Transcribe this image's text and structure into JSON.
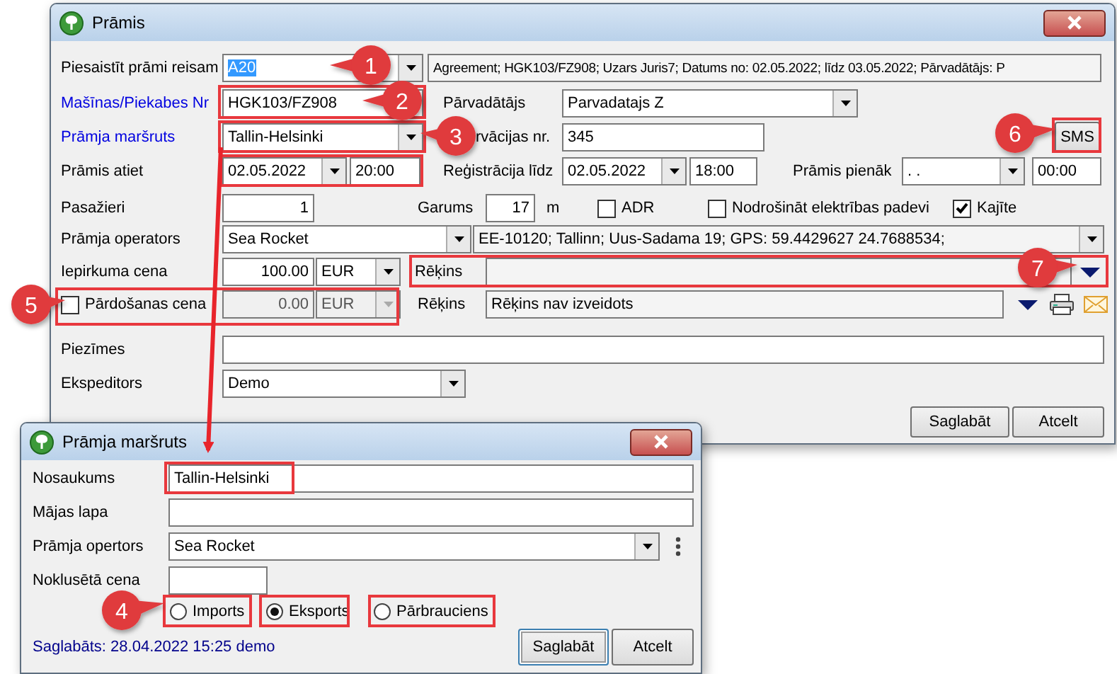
{
  "main_window": {
    "title": "Prāmis",
    "link_trip": {
      "label": "Piesaistīt prāmi reisam",
      "value": "A20",
      "value_selected": true,
      "details": "Agreement; HGK103/FZ908; Uzars Juris7; Datums no: 02.05.2022; līdz 03.05.2022; Pārvadātājs: P"
    },
    "vehicle_nr": {
      "label": "Mašīnas/Piekabes Nr",
      "link": true,
      "value": "HGK103/FZ908"
    },
    "carrier": {
      "label": "Pārvadātājs",
      "value": "Parvadatajs Z"
    },
    "route": {
      "label": "Prāmja maršruts",
      "link": true,
      "value": "Tallin-Helsinki"
    },
    "reservation_nr": {
      "label": "rvācijas nr.",
      "value": "345"
    },
    "sms_button": "SMS",
    "departure": {
      "label": "Prāmis atiet",
      "date": "02.05.2022",
      "time": "20:00"
    },
    "registration_until": {
      "label": "Reģistrācija līdz",
      "date": "02.05.2022",
      "time": "18:00"
    },
    "arrival": {
      "label": "Prāmis pienāk",
      "date": ". .",
      "time": "00:00"
    },
    "passengers": {
      "label": "Pasažieri",
      "value": "1"
    },
    "length": {
      "label": "Garums",
      "value": "17",
      "unit": "m"
    },
    "options": [
      {
        "label": "ADR",
        "checked": false
      },
      {
        "label": "Nodrošināt elektrības padevi",
        "checked": false
      },
      {
        "label": "Kajīte",
        "checked": true
      }
    ],
    "operator": {
      "label": "Prāmja operators",
      "value": "Sea Rocket",
      "details": "EE-10120; Tallinn; Uus-Sadama 19; GPS: 59.4429627 24.7688534;"
    },
    "purchase_price": {
      "label": "Iepirkuma cena",
      "value": "100.00",
      "currency": "EUR",
      "invoice_label": "Rēķins"
    },
    "sale_price": {
      "label": "Pārdošanas cena",
      "checked": false,
      "value": "0.00",
      "currency": "EUR",
      "invoice_label": "Rēķins",
      "invoice": "Rēķins nav izveidots"
    },
    "notes": {
      "label": "Piezīmes"
    },
    "forwarder": {
      "label": "Ekspeditors",
      "value": "Demo"
    },
    "buttons": [
      "Saglabāt",
      "Atcelt"
    ]
  },
  "route_window": {
    "title": "Prāmja maršruts",
    "name": {
      "label": "Nosaukums",
      "value": "Tallin-Helsinki"
    },
    "homepage": {
      "label": "Mājas lapa"
    },
    "operator": {
      "label": "Prāmja opertors",
      "value": "Sea Rocket"
    },
    "default_price": {
      "label": "Noklusētā cena"
    },
    "direction": [
      {
        "label": "Imports",
        "selected": false
      },
      {
        "label": "Eksports",
        "selected": true
      },
      {
        "label": "Pārbrauciens",
        "selected": false
      }
    ],
    "saved": "Saglabāts: 28.04.2022 15:25 demo",
    "buttons": [
      "Saglabāt",
      "Atcelt"
    ]
  },
  "callouts": [
    {
      "number": "1"
    },
    {
      "number": "2"
    },
    {
      "number": "3"
    },
    {
      "number": "4"
    },
    {
      "number": "5"
    },
    {
      "number": "6"
    },
    {
      "number": "7"
    }
  ]
}
